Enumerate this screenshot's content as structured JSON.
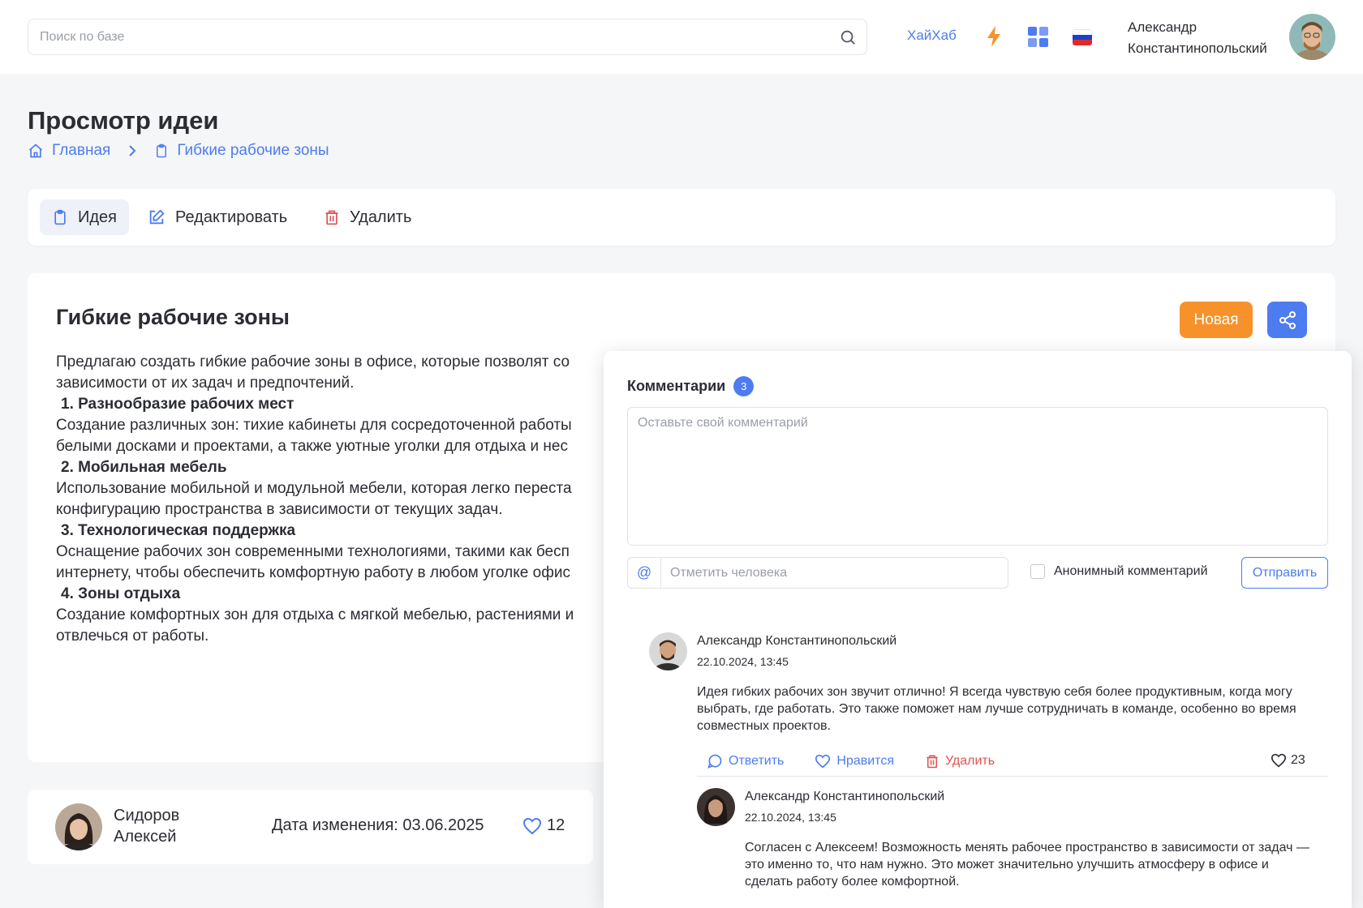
{
  "header": {
    "search_placeholder": "Поиск по базе",
    "hub_link": "ХайХаб",
    "user_name_line1": "Александр",
    "user_name_line2": "Константинопольский",
    "accent_color": "#4d7cf0"
  },
  "page": {
    "title": "Просмотр идеи",
    "breadcrumb": {
      "home": "Главная",
      "current": "Гибкие рабочие зоны"
    }
  },
  "tabs": [
    {
      "label": "Идея",
      "icon": "clipboard-icon"
    },
    {
      "label": "Редактировать",
      "icon": "edit-icon"
    },
    {
      "label": "Удалить",
      "icon": "trash-icon"
    }
  ],
  "idea": {
    "title": "Гибкие рабочие зоны",
    "status": "Новая",
    "status_color": "#f7922b",
    "intro": "Предлагаю создать гибкие рабочие зоны в офисе, которые позволят со",
    "intro2": "зависимости от их задач и предпочтений.",
    "items": [
      {
        "head": "1. Разнообразие рабочих мест",
        "line1": "Создание различных зон: тихие кабинеты для сосредоточенной работы",
        "line2": "белыми досками и проектами, а также уютные уголки для отдыха и нес"
      },
      {
        "head": "2. Мобильная мебель",
        "line1": "Использование мобильной и модульной мебели, которая легко переста",
        "line2": "конфигурацию пространства в зависимости от текущих задач."
      },
      {
        "head": "3. Технологическая поддержка",
        "line1": "Оснащение рабочих зон современными технологиями, такими как бесп",
        "line2": "интернету, чтобы обеспечить комфортную работу в любом уголке офис"
      },
      {
        "head": "4. Зоны отдыха",
        "line1": "Создание комфортных зон для отдыха с мягкой мебелью, растениями и",
        "line2": "отвлечься от работы."
      }
    ]
  },
  "author": {
    "name_line1": "Сидоров",
    "name_line2": "Алексей",
    "changed": "Дата изменения: 03.06.2025",
    "likes": "12"
  },
  "comments": {
    "title": "Комментарии",
    "count": "3",
    "textarea_placeholder": "Оставьте свой комментарий",
    "mention_symbol": "@",
    "mention_placeholder": "Отметить человека",
    "anonymous_label": "Анонимный комментарий",
    "send_label": "Отправить",
    "list": [
      {
        "author": "Александр Константинопольский",
        "date": "22.10.2024, 13:45",
        "text": "Идея гибких рабочих зон звучит отлично! Я всегда чувствую себя более продуктивным, когда могу выбрать, где работать. Это также поможет нам лучше сотрудничать в команде, особенно во время совместных проектов.",
        "reply": "Ответить",
        "like": "Нравится",
        "delete": "Удалить",
        "likes": "23"
      },
      {
        "author": "Александр Константинопольский",
        "date": "22.10.2024, 13:45",
        "text": "Согласен с Алексеем! Возможность менять рабочее пространство в зависимости от задач — это именно то, что нам нужно. Это может значительно улучшить атмосферу в офисе и сделать работу более комфортной."
      }
    ]
  }
}
